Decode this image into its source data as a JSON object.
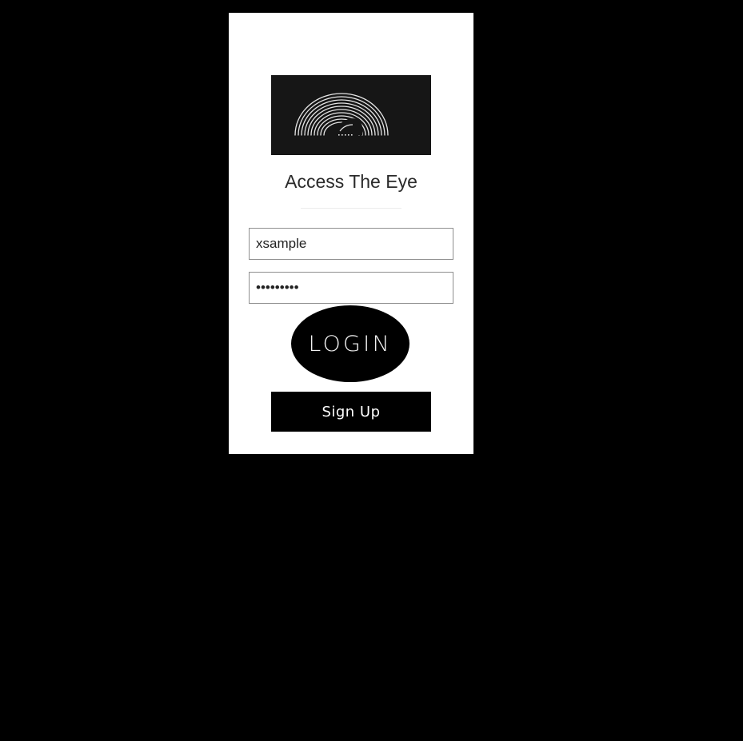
{
  "login_card": {
    "logo_icon": "eye-arc-logo",
    "title": "Access The Eye",
    "username": {
      "value": "xsample",
      "placeholder": ""
    },
    "password": {
      "value": "•••••••••",
      "placeholder": ""
    },
    "login_label": "LOGIN",
    "signup_label": "Sign Up"
  },
  "colors": {
    "page_background": "#000000",
    "card_background": "#ffffff",
    "logo_background": "#161616",
    "button_background": "#000000",
    "button_text": "#ffffff",
    "title_text": "#2b2b2b"
  }
}
